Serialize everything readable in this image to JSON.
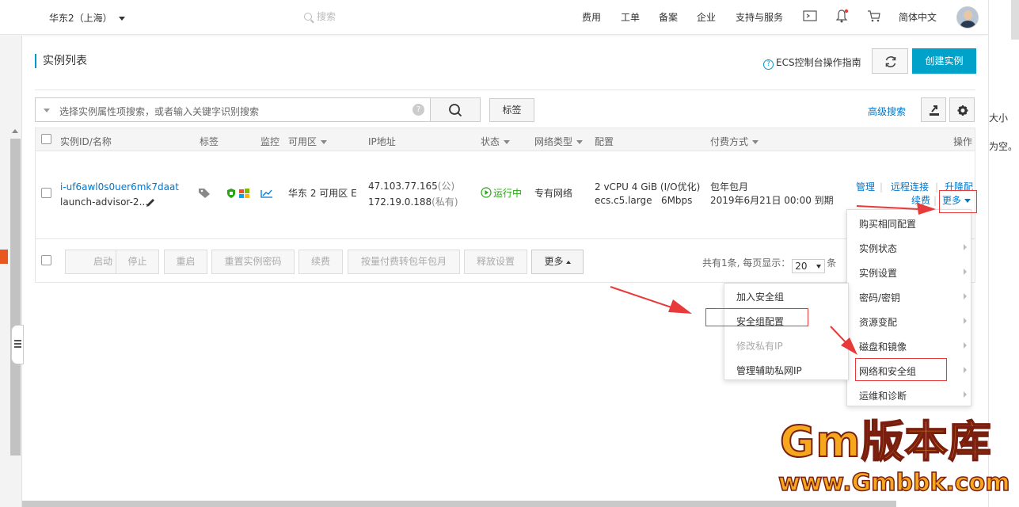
{
  "topbar": {
    "region": "华东2（上海）",
    "search_placeholder": "搜索",
    "nav": [
      "费用",
      "工单",
      "备案",
      "企业",
      "支持与服务"
    ],
    "language": "简体中文"
  },
  "page": {
    "title": "实例列表",
    "guide": "ECS控制台操作指南",
    "create_button": "创建实例"
  },
  "search": {
    "placeholder": "选择实例属性项搜索，或者输入关键字识别搜索",
    "tag_button": "标签",
    "advanced": "高级搜索"
  },
  "table": {
    "headers": {
      "id": "实例ID/名称",
      "tag": "标签",
      "monitor": "监控",
      "zone": "可用区",
      "ip": "IP地址",
      "status": "状态",
      "network": "网络类型",
      "config": "配置",
      "billing": "付费方式",
      "ops": "操作"
    },
    "row": {
      "id": "i-uf6awl0s0uer6mk7daat",
      "name": "launch-advisor-2...",
      "zone": "华东 2 可用区 E",
      "ip_public": "47.103.77.165",
      "ip_public_tag": "(公)",
      "ip_private": "172.19.0.188",
      "ip_private_tag": "(私有)",
      "status": "运行中",
      "network": "专有网络",
      "config_line1": "2 vCPU 4 GiB (I/O优化)",
      "config_line2": "ecs.c5.large   6Mbps",
      "billing_line1": "包年包月",
      "billing_line2": "2019年6月21日 00:00 到期",
      "ops": {
        "manage": "管理",
        "remote": "远程连接",
        "upgrade": "升降配",
        "renew": "续费",
        "more": "更多"
      }
    },
    "footer": {
      "buttons": [
        "启动",
        "停止",
        "重启",
        "重置实例密码",
        "续费",
        "按量付费转包年包月",
        "释放设置"
      ],
      "more": "更多",
      "page_info_prefix": "共有1条, 每页显示：",
      "page_size": "20",
      "page_info_suffix": "条"
    }
  },
  "more_menu": {
    "items": [
      "购买相同配置",
      "实例状态",
      "实例设置",
      "密码/密钥",
      "资源变配",
      "磁盘和镜像",
      "网络和安全组",
      "运维和诊断"
    ]
  },
  "sub_menu": {
    "items": [
      "加入安全组",
      "安全组配置",
      "修改私有IP",
      "管理辅助私网IP"
    ]
  },
  "right_edge": {
    "line1": "大小",
    "line2": "为空。"
  },
  "watermark": {
    "line1": "Gm版本库",
    "line2": "www.Gmbbk.com"
  },
  "colors": {
    "accent": "#00a2ca",
    "link": "#0077cc",
    "running": "#2aa515",
    "highlight_box": "#e83a3a"
  }
}
